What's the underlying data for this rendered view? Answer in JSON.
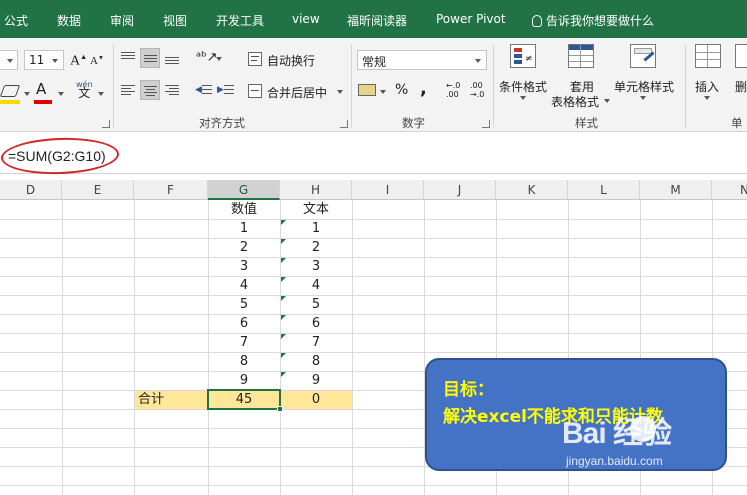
{
  "ribbon_tabs": [
    "公式",
    "数据",
    "审阅",
    "视图",
    "开发工具",
    "view",
    "福昕阅读器",
    "Power Pivot"
  ],
  "tell_me": "告诉我你想要做什么",
  "font": {
    "size": "11",
    "phonetic_label": "wén",
    "phonetic_char": "文",
    "font_color_letter": "A"
  },
  "alignment": {
    "wrap_text": "自动换行",
    "merge_center": "合并后居中",
    "group_label": "对齐方式"
  },
  "number": {
    "format": "常规",
    "percent": "%",
    "comma": ",",
    "inc_decimal": "←.0\n.00",
    "dec_decimal": ".00\n→.0",
    "group_label": "数字"
  },
  "styles": {
    "conditional": "条件格式",
    "table_format_1": "套用",
    "table_format_2": "表格格式",
    "cell_styles": "单元格样式",
    "group_label": "样式"
  },
  "cells": {
    "insert": "插入",
    "delete": "删",
    "group_label": "单"
  },
  "formula_bar": {
    "formula": "=SUM(G2:G10)"
  },
  "columns": [
    "D",
    "E",
    "F",
    "G",
    "H",
    "I",
    "J",
    "K",
    "L",
    "M",
    "N"
  ],
  "selected_column": "G",
  "table": {
    "header_g": "数值",
    "header_h": "文本",
    "values_g": [
      "1",
      "2",
      "3",
      "4",
      "5",
      "6",
      "7",
      "8",
      "9"
    ],
    "values_h": [
      "1",
      "2",
      "3",
      "4",
      "5",
      "6",
      "7",
      "8",
      "9"
    ],
    "total_label": "合计",
    "total_g": "45",
    "total_h": "0"
  },
  "callout": {
    "title": "目标：",
    "body": "解决excel不能求和只能计数"
  },
  "watermark": {
    "brand_text": "Bai  经验",
    "url": "jingyan.baidu.com"
  },
  "colors": {
    "ribbon_green": "#217346",
    "highlight_yellow": "#ffe699",
    "callout_blue": "#4472c4",
    "callout_text": "#ffff00",
    "annotation_red": "#d0272b"
  }
}
